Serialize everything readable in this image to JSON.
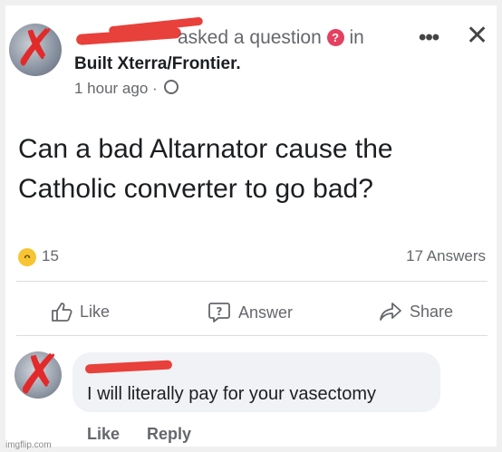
{
  "post": {
    "asked_text": "asked a question",
    "question_badge_icon": "question-badge-icon",
    "in_text": "in",
    "group_name": "Built Xterra/Frontier.",
    "timestamp": "1 hour ago",
    "separator": "·",
    "privacy_icon": "globe-icon",
    "more_label": "•••",
    "close_label": "✕",
    "question": "Can a bad Altarnator cause the Catholic converter to go bad?"
  },
  "reactions": {
    "emoji_icon": "haha-reaction-icon",
    "count": "15",
    "answers": "17 Answers"
  },
  "actions": {
    "like": "Like",
    "answer": "Answer",
    "share": "Share"
  },
  "comment": {
    "text": "I will literally pay for your vasectomy",
    "like": "Like",
    "reply": "Reply"
  },
  "watermark": "imgflip.com",
  "colors": {
    "redaction": "#e8403a",
    "muted_text": "#65676b",
    "bubble": "#f0f2f5"
  }
}
